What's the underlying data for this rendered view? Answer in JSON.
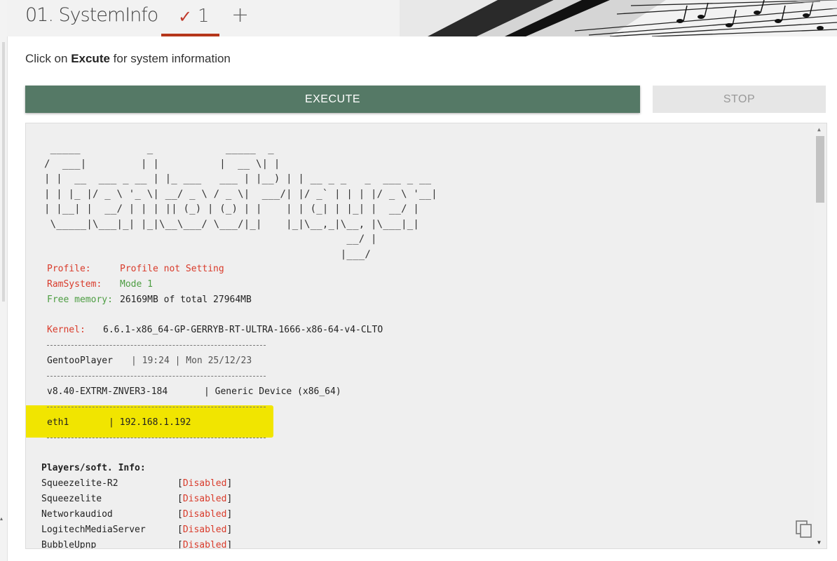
{
  "tabs": {
    "title": "01. SystemInfo",
    "active_check": "✓",
    "active_number": "1",
    "add_label": "+"
  },
  "instruction": {
    "prefix": "Click on ",
    "bold": "Excute",
    "suffix": " for system information"
  },
  "buttons": {
    "execute": "EXECUTE",
    "stop": "STOP"
  },
  "ascii_art": " _____           _            _____  _\n/  ___|         | |          |  __ \\| |\n| |  __  ___ _ __ | |_ ___   ___ | |__) | | __ _ _   _  ___ _ __\n| | |_ |/ _ \\ '_ \\| __/ _ \\ / _ \\|  ___/| |/ _` | | | |/ _ \\ '__|\n| |__| |  __/ | | | || (_) | (_) | |    | | (_| | |_| |  __/ |\n \\_____|\\___|_| |_|\\__\\___/ \\___/|_|    |_|\\__,_|\\__, |\\___|_|\n                                                  __/ |\n                                                 |___/",
  "status": {
    "profile_label": "Profile:",
    "profile_value": "Profile not Setting",
    "ramsystem_label": "RamSystem:",
    "ramsystem_value": "Mode 1",
    "freemem_label": "Free memory:",
    "freemem_value": "26169MB of total 27964MB"
  },
  "kernel": {
    "label": "Kernel:",
    "value": "6.6.1-x86_64-GP-GERRYB-RT-ULTRA-1666-x86-64-v4-CLTO"
  },
  "info": {
    "app_name": "GentooPlayer",
    "datetime": "| 19:24 | Mon 25/12/23",
    "version": "v8.40-EXTRM-ZNVER3-184",
    "device": "| Generic Device (x86_64)",
    "iface": "eth1",
    "ip": "| 192.168.1.192"
  },
  "players": {
    "header": "Players/soft. Info:",
    "items": [
      {
        "name": "Squeezelite-R2",
        "status": "Disabled"
      },
      {
        "name": "Squeezelite",
        "status": "Disabled"
      },
      {
        "name": "Networkaudiod",
        "status": "Disabled"
      },
      {
        "name": "LogitechMediaServer",
        "status": "Disabled"
      },
      {
        "name": "BubbleUpnp",
        "status": "Disabled"
      }
    ]
  },
  "colors": {
    "execute_bg": "#557966",
    "tab_accent": "#b5361b",
    "highlight": "#f1e500",
    "red_text": "#d93b2b",
    "green_text": "#4d9d42"
  }
}
